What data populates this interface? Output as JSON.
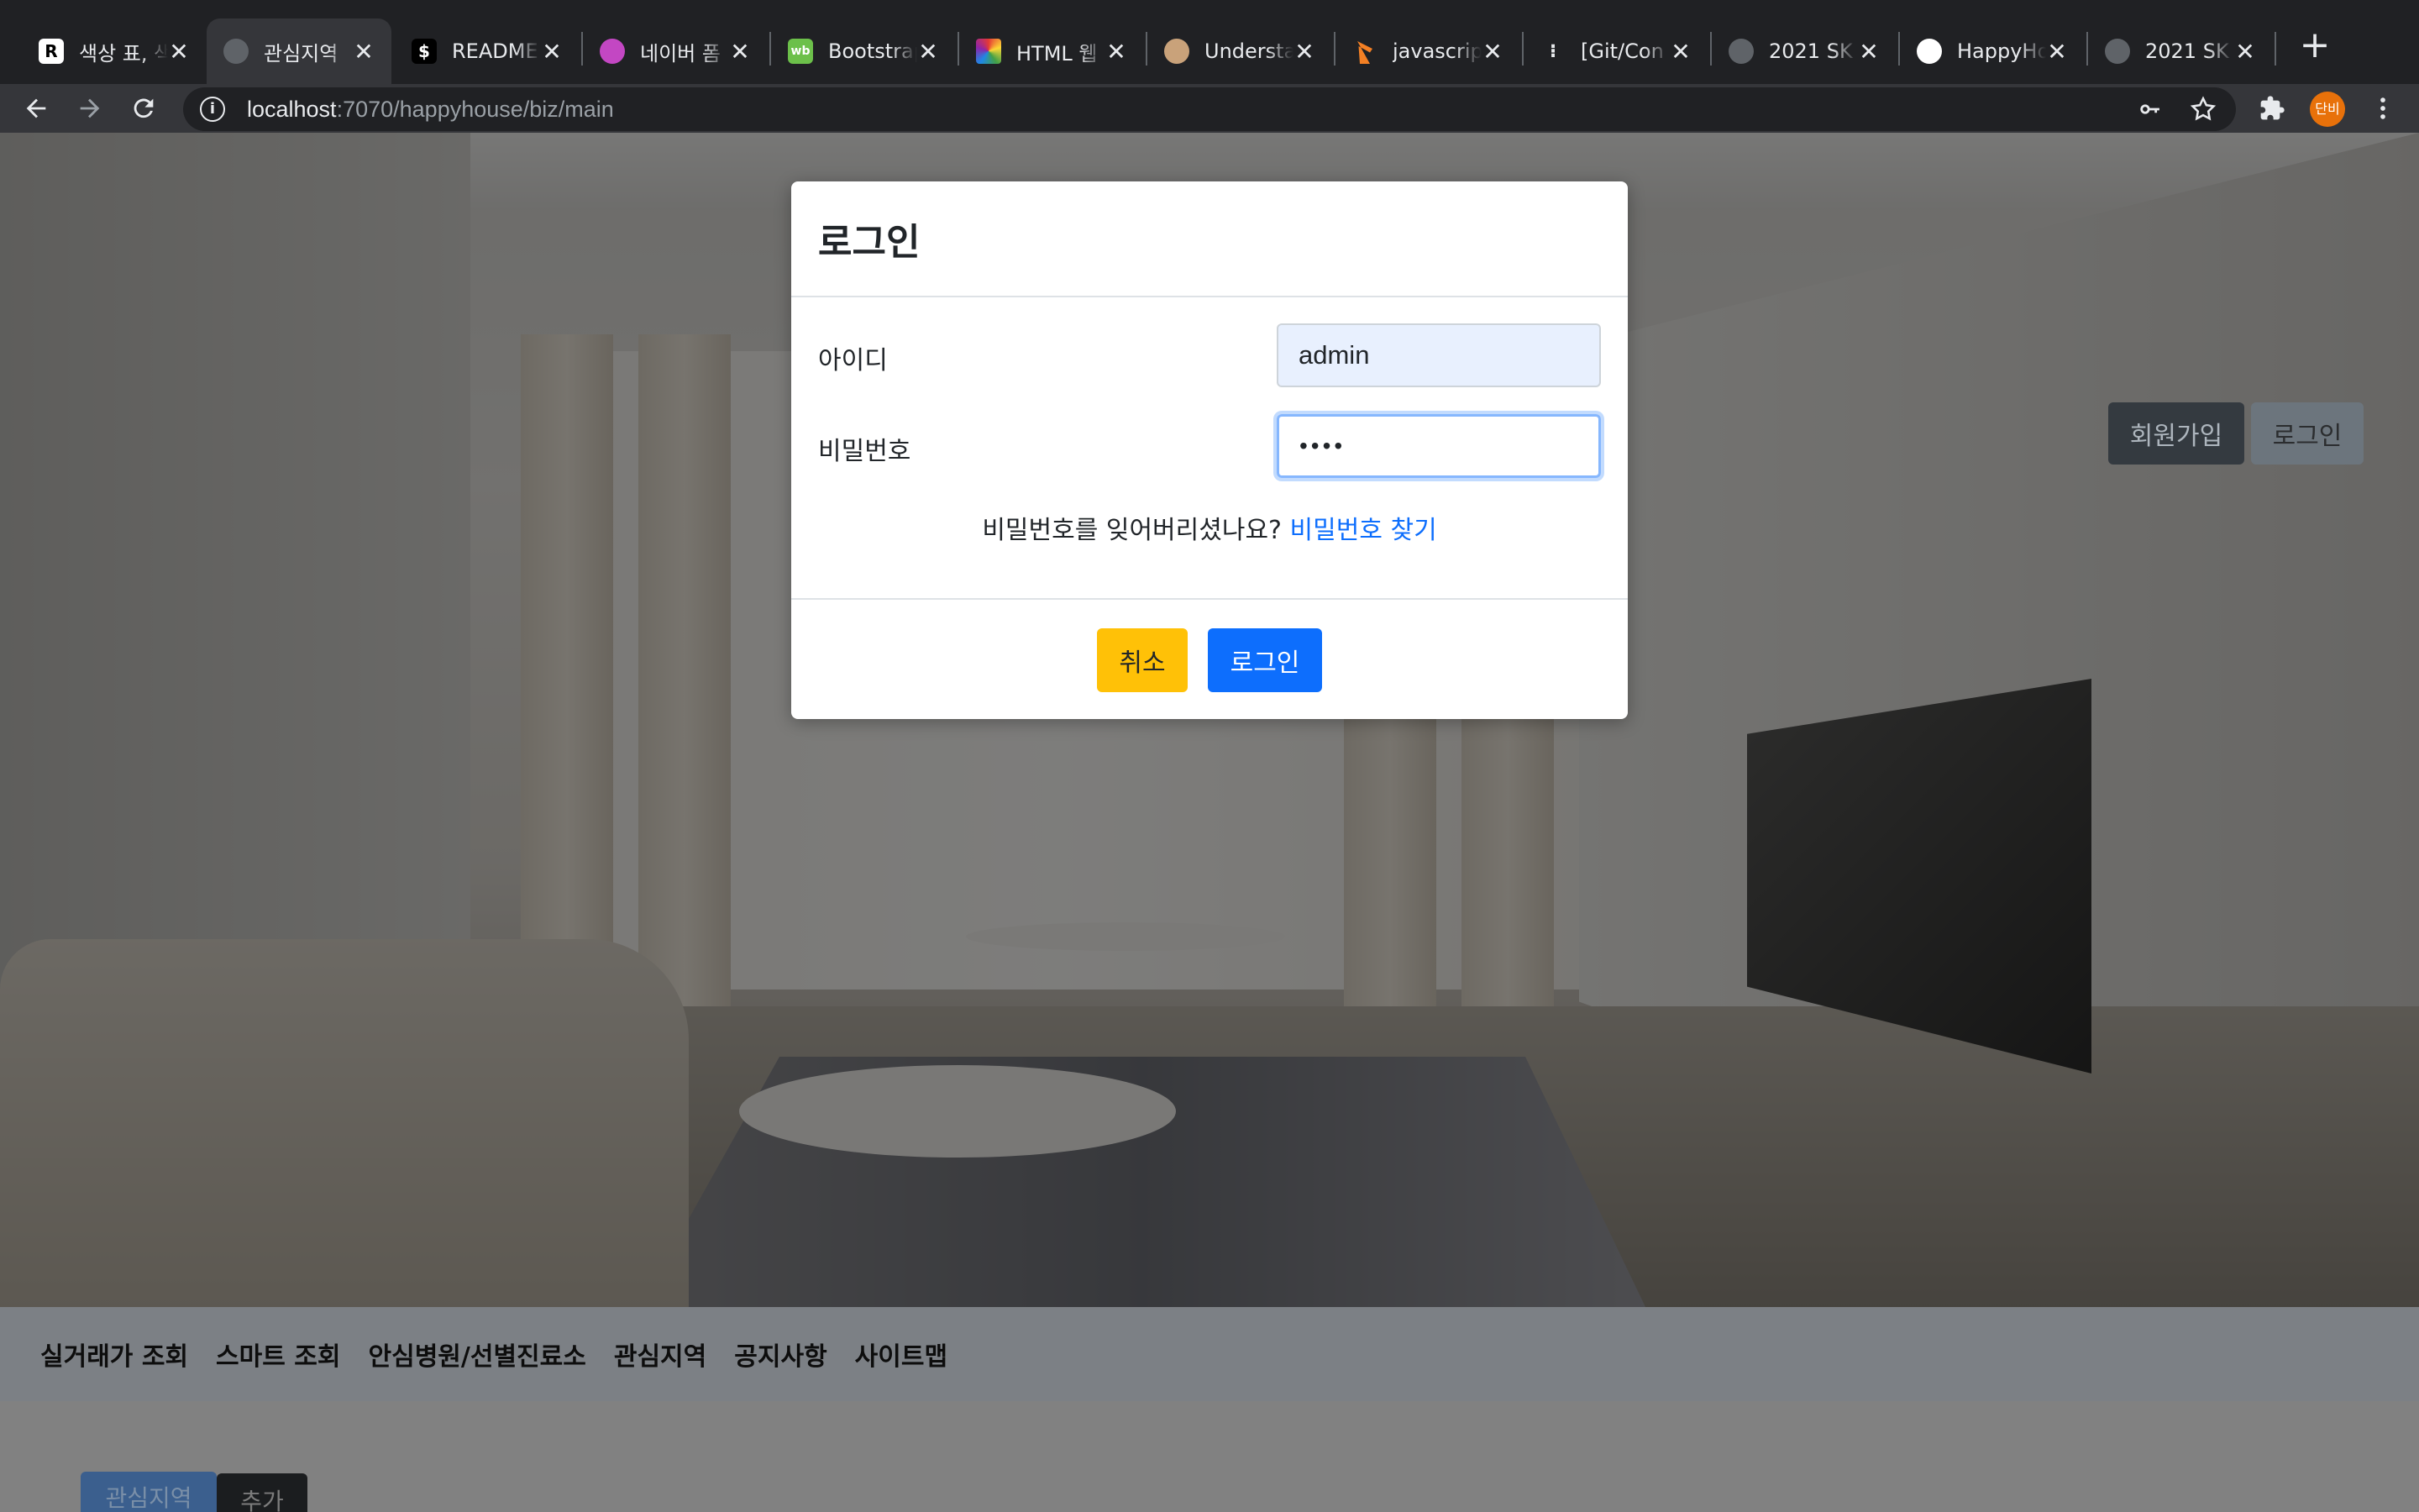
{
  "browser": {
    "tabs": [
      {
        "title": "색상 표, 색",
        "favicon": "R",
        "active": false
      },
      {
        "title": "관심지역",
        "favicon": "globe",
        "active": true
      },
      {
        "title": "README",
        "favicon": "$",
        "active": false
      },
      {
        "title": "네이버 폼",
        "favicon": "form",
        "active": false
      },
      {
        "title": "Bootstrap",
        "favicon": "wb",
        "active": false
      },
      {
        "title": "HTML 웹",
        "favicon": "color-wheel",
        "active": false
      },
      {
        "title": "Understa",
        "favicon": "owl",
        "active": false
      },
      {
        "title": "javascript",
        "favicon": "stack",
        "active": false
      },
      {
        "title": "[Git/Con",
        "favicon": "dots",
        "active": false
      },
      {
        "title": "2021 SK",
        "favicon": "globe",
        "active": false
      },
      {
        "title": "HappyHo",
        "favicon": "github",
        "active": false
      },
      {
        "title": "2021 SK",
        "favicon": "globe",
        "active": false
      }
    ],
    "url_host": "localhost",
    "url_path": ":7070/happyhouse/biz/main",
    "profile_label": "단비"
  },
  "header": {
    "join_label": "회원가입",
    "login_label": "로그인"
  },
  "nav": {
    "items": [
      "실거래가 조회",
      "스마트 조회",
      "안심병원/선별진료소",
      "관심지역",
      "공지사항",
      "사이트맵"
    ]
  },
  "subtabs": {
    "first": "관심지역",
    "second": "추가"
  },
  "modal": {
    "title": "로그인",
    "id_label": "아이디",
    "id_value": "admin",
    "pw_label": "비밀번호",
    "pw_value": "••••",
    "forgot_text": "비밀번호를 잊어버리셨나요?",
    "forgot_link": "비밀번호 찾기",
    "cancel_label": "취소",
    "login_label": "로그인"
  }
}
